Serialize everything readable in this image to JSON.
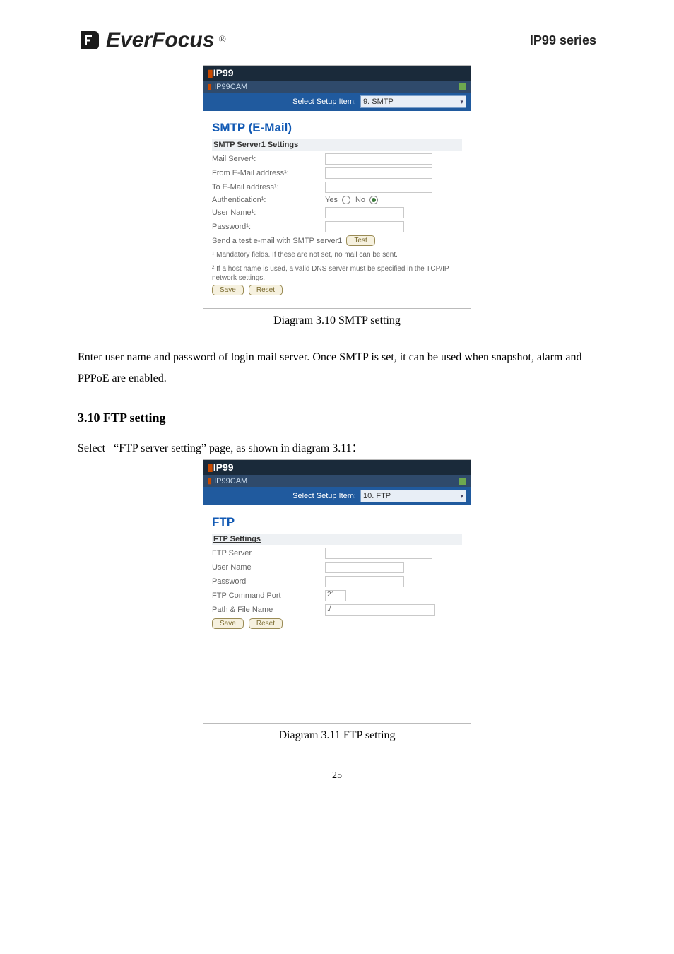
{
  "header": {
    "brand": "EverFocus",
    "reg": "®",
    "series": "IP99 series"
  },
  "panel1": {
    "titlebar": "IP99",
    "sub": "IP99CAM",
    "select_label": "Select Setup Item:",
    "select_value": "9. SMTP",
    "heading": "SMTP (E-Mail)",
    "section_title": "SMTP Server1 Settings",
    "rows": {
      "mail_server": "Mail Server¹:",
      "from_email": "From E-Mail address¹:",
      "to_email": "To E-Mail address¹:",
      "auth": "Authentication¹:",
      "yes": "Yes",
      "no": "No",
      "user": "User Name¹:",
      "pass": "Password¹:",
      "send_test": "Send a test e-mail with SMTP server1",
      "test_btn": "Test"
    },
    "foot1": "¹ Mandatory fields. If these are not set, no mail can be sent.",
    "foot2": "² If a host name is used, a valid DNS server must be specified in the TCP/IP network settings.",
    "save": "Save",
    "reset": "Reset"
  },
  "caption1": "Diagram 3.10 SMTP setting",
  "para1": "Enter user name and password of login mail server. Once SMTP is set, it can be used when snapshot, alarm and PPPoE are enabled.",
  "section_head": "3.10 FTP setting",
  "para2_pre": "Select   “FTP server setting” page, as shown in diagram 3.11：",
  "panel2": {
    "titlebar": "IP99",
    "sub": "IP99CAM",
    "select_label": "Select Setup Item:",
    "select_value": "10. FTP",
    "heading": "FTP",
    "section_title": "FTP Settings",
    "rows": {
      "ftp_server": "FTP Server",
      "user_name": "User Name",
      "password": "Password",
      "cmd_port": "FTP Command Port",
      "cmd_port_val": "21",
      "path": "Path & File Name",
      "path_val": "./"
    },
    "save": "Save",
    "reset": "Reset"
  },
  "caption2": "Diagram 3.11 FTP setting",
  "pagenum": "25"
}
